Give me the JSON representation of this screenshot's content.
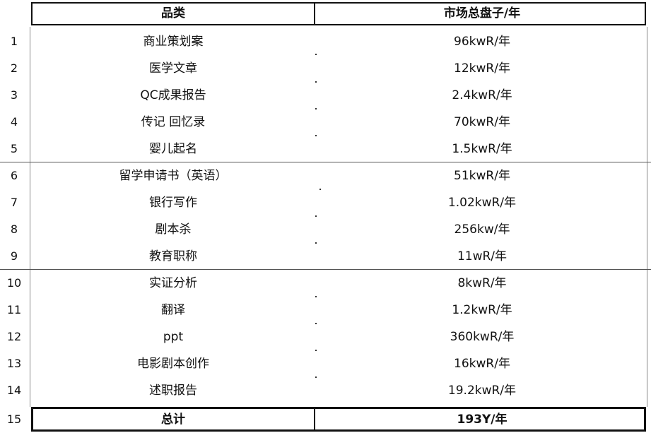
{
  "table": {
    "header": {
      "row_num": "",
      "col1": "品类",
      "col2": "市场总盘子/年"
    },
    "rows": [
      {
        "num": "1",
        "category": "商业策划案",
        "market": "96kwR/年"
      },
      {
        "num": "2",
        "category": "医学文章",
        "market": "12kwR/年"
      },
      {
        "num": "3",
        "category": "QC成果报告",
        "market": "2.4kwR/年"
      },
      {
        "num": "4",
        "category": "传记 回忆录",
        "market": "70kwR/年"
      },
      {
        "num": "5",
        "category": "婴儿起名",
        "market": "1.5kwR/年"
      },
      {
        "num": "6",
        "category": "留学申请书（英语）",
        "market": "51kwR/年"
      },
      {
        "num": "7",
        "category": "银行写作",
        "market": "1.02kwR/年"
      },
      {
        "num": "8",
        "category": "剧本杀",
        "market": "256kw/年"
      },
      {
        "num": "9",
        "category": "教育职称",
        "market": "11wR/年"
      },
      {
        "num": "10",
        "category": "实证分析",
        "market": "8kwR/年"
      },
      {
        "num": "11",
        "category": "翻译",
        "market": "1.2kwR/年"
      },
      {
        "num": "12",
        "category": "ppt",
        "market": "360kwR/年"
      },
      {
        "num": "13",
        "category": "电影剧本创作",
        "market": "16kwR/年"
      },
      {
        "num": "14",
        "category": "述职报告",
        "market": "19.2kwR/年"
      }
    ],
    "total": {
      "num": "15",
      "label": "总计",
      "value": "193Y/年"
    }
  }
}
